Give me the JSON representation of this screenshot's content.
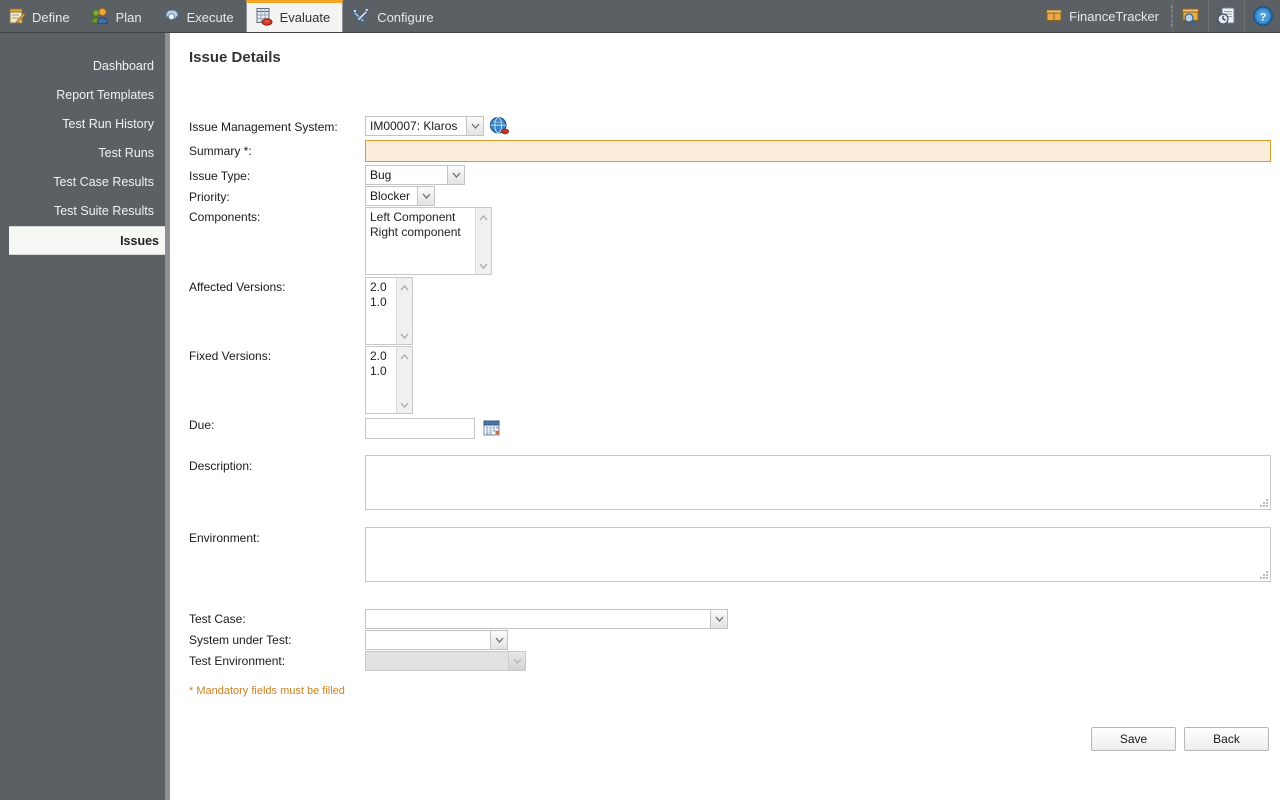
{
  "topnav": {
    "tabs": [
      {
        "label": "Define",
        "icon": "notepad-pencil-icon",
        "selected": false
      },
      {
        "label": "Plan",
        "icon": "users-icon",
        "selected": false
      },
      {
        "label": "Execute",
        "icon": "gear-icon",
        "selected": false
      },
      {
        "label": "Evaluate",
        "icon": "report-chart-icon",
        "selected": true
      },
      {
        "label": "Configure",
        "icon": "tools-icon",
        "selected": false
      }
    ],
    "project": {
      "label": "FinanceTracker",
      "icon": "box-icon"
    },
    "right_icons": [
      {
        "name": "box-search-icon"
      },
      {
        "name": "recent-documents-icon"
      },
      {
        "name": "help-icon"
      }
    ]
  },
  "sidebar": {
    "items": [
      {
        "label": "Dashboard",
        "selected": false
      },
      {
        "label": "Report Templates",
        "selected": false
      },
      {
        "label": "Test Run History",
        "selected": false
      },
      {
        "label": "Test Runs",
        "selected": false
      },
      {
        "label": "Test Case Results",
        "selected": false
      },
      {
        "label": "Test Suite Results",
        "selected": false
      },
      {
        "label": "Issues",
        "selected": true
      }
    ]
  },
  "page": {
    "title": "Issue Details",
    "mandatory_note": "* Mandatory fields must be filled"
  },
  "fields": {
    "ims": {
      "label": "Issue Management System:",
      "value": "IM00007: Klaros",
      "globe_icon": "globe-icon"
    },
    "summary": {
      "label": "Summary *:",
      "value": "",
      "placeholder": ""
    },
    "issue_type": {
      "label": "Issue Type:",
      "value": "Bug"
    },
    "priority": {
      "label": "Priority:",
      "value": "Blocker"
    },
    "components": {
      "label": "Components:",
      "options": [
        "Left Component",
        "Right component"
      ]
    },
    "affected_versions": {
      "label": "Affected Versions:",
      "options": [
        "2.0",
        "1.0"
      ]
    },
    "fixed_versions": {
      "label": "Fixed Versions:",
      "options": [
        "2.0",
        "1.0"
      ]
    },
    "due": {
      "label": "Due:",
      "value": "",
      "calendar_icon": "calendar-icon"
    },
    "description": {
      "label": "Description:",
      "value": ""
    },
    "environment": {
      "label": "Environment:",
      "value": ""
    },
    "test_case": {
      "label": "Test Case:",
      "value": ""
    },
    "system_under_test": {
      "label": "System under Test:",
      "value": ""
    },
    "test_environment": {
      "label": "Test Environment:",
      "value": "",
      "disabled": true
    }
  },
  "actions": {
    "save_label": "Save",
    "back_label": "Back"
  },
  "colors": {
    "chrome": "#5b6064",
    "accent": "#f5a623",
    "mandatory_bg": "#faeedb",
    "mandatory_border": "#e09a2b",
    "note_text": "#d08020"
  }
}
